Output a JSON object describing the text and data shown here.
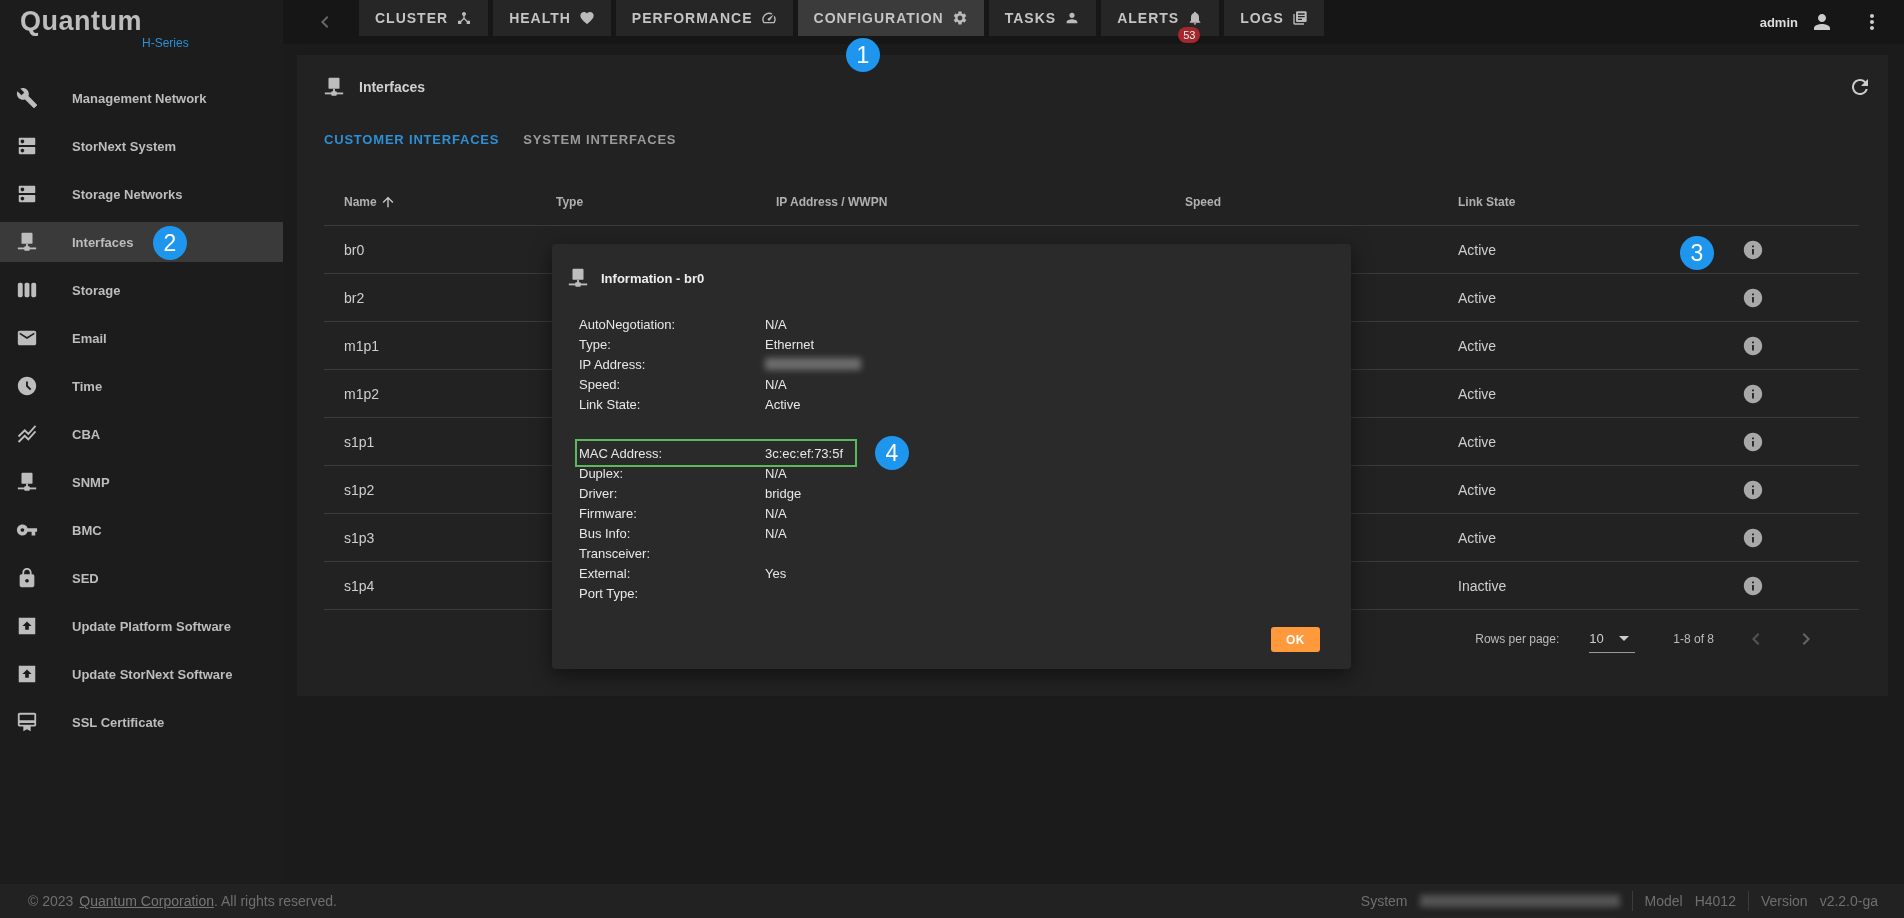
{
  "brand": {
    "name": "Quantum",
    "subtitle": "H-Series"
  },
  "nav": {
    "tabs": [
      {
        "label": "CLUSTER",
        "selected": false
      },
      {
        "label": "HEALTH",
        "selected": false
      },
      {
        "label": "PERFORMANCE",
        "selected": false
      },
      {
        "label": "CONFIGURATION",
        "selected": true
      },
      {
        "label": "TASKS",
        "selected": false
      },
      {
        "label": "ALERTS",
        "selected": false,
        "badge": "53"
      },
      {
        "label": "LOGS",
        "selected": false
      }
    ]
  },
  "user": {
    "name": "admin"
  },
  "sidebar": {
    "items": [
      {
        "label": "Management Network",
        "selected": false
      },
      {
        "label": "StorNext System",
        "selected": false
      },
      {
        "label": "Storage Networks",
        "selected": false
      },
      {
        "label": "Interfaces",
        "selected": true
      },
      {
        "label": "Storage",
        "selected": false
      },
      {
        "label": "Email",
        "selected": false
      },
      {
        "label": "Time",
        "selected": false
      },
      {
        "label": "CBA",
        "selected": false
      },
      {
        "label": "SNMP",
        "selected": false
      },
      {
        "label": "BMC",
        "selected": false
      },
      {
        "label": "SED",
        "selected": false
      },
      {
        "label": "Update Platform Software",
        "selected": false
      },
      {
        "label": "Update StorNext Software",
        "selected": false
      },
      {
        "label": "SSL Certificate",
        "selected": false
      }
    ]
  },
  "panel": {
    "title": "Interfaces",
    "tabs": [
      {
        "label": "CUSTOMER INTERFACES",
        "selected": true
      },
      {
        "label": "SYSTEM INTERFACES",
        "selected": false
      }
    ],
    "table": {
      "columns": [
        {
          "label": "Name",
          "sorted": true
        },
        {
          "label": "Type",
          "sorted": false
        },
        {
          "label": "IP Address / WWPN",
          "sorted": false
        },
        {
          "label": "Speed",
          "sorted": false
        },
        {
          "label": "Link State",
          "sorted": false
        }
      ],
      "rows": [
        {
          "name": "br0",
          "link_state": "Active"
        },
        {
          "name": "br2",
          "link_state": "Active"
        },
        {
          "name": "m1p1",
          "link_state": "Active"
        },
        {
          "name": "m1p2",
          "link_state": "Active"
        },
        {
          "name": "s1p1",
          "link_state": "Active"
        },
        {
          "name": "s1p2",
          "link_state": "Active"
        },
        {
          "name": "s1p3",
          "link_state": "Active"
        },
        {
          "name": "s1p4",
          "link_state": "Inactive"
        }
      ]
    },
    "pagination": {
      "rows_per_page_label": "Rows per page:",
      "rows_per_page": "10",
      "range": "1-8 of 8"
    }
  },
  "dialog": {
    "title": "Information - br0",
    "ok": "OK",
    "groups": [
      [
        {
          "label": "AutoNegotiation:",
          "value": "N/A",
          "kind": "text",
          "highlighted": false
        },
        {
          "label": "Type:",
          "value": "Ethernet",
          "kind": "text",
          "highlighted": false
        },
        {
          "label": "IP Address:",
          "kind": "redacted",
          "highlighted": false
        },
        {
          "label": "Speed:",
          "value": "N/A",
          "kind": "text",
          "highlighted": false
        },
        {
          "label": "Link State:",
          "value": "Active",
          "kind": "text",
          "highlighted": false
        }
      ],
      [
        {
          "label": "MAC Address:",
          "value": "3c:ec:ef:73:5f",
          "kind": "text",
          "highlighted": true
        },
        {
          "label": "Duplex:",
          "value": "N/A",
          "kind": "text",
          "highlighted": false
        },
        {
          "label": "Driver:",
          "value": "bridge",
          "kind": "text",
          "highlighted": false
        },
        {
          "label": "Firmware:",
          "value": "N/A",
          "kind": "text",
          "highlighted": false
        },
        {
          "label": "Bus Info:",
          "value": "N/A",
          "kind": "text",
          "highlighted": false
        },
        {
          "label": "Transceiver:",
          "kind": "text",
          "highlighted": false
        },
        {
          "label": "External:",
          "value": "Yes",
          "kind": "text",
          "highlighted": false
        },
        {
          "label": "Port Type:",
          "kind": "text",
          "highlighted": false
        }
      ]
    ]
  },
  "callouts": [
    {
      "number": "1"
    },
    {
      "number": "2"
    },
    {
      "number": "3"
    },
    {
      "number": "4"
    }
  ],
  "footer": {
    "copyright": "© 2023",
    "company_link": "Quantum Corporation",
    "rights": ". All rights reserved.",
    "system_label": "System",
    "model_label": "Model",
    "model": "H4012",
    "version_label": "Version",
    "version": "v2.2.0-ga"
  }
}
